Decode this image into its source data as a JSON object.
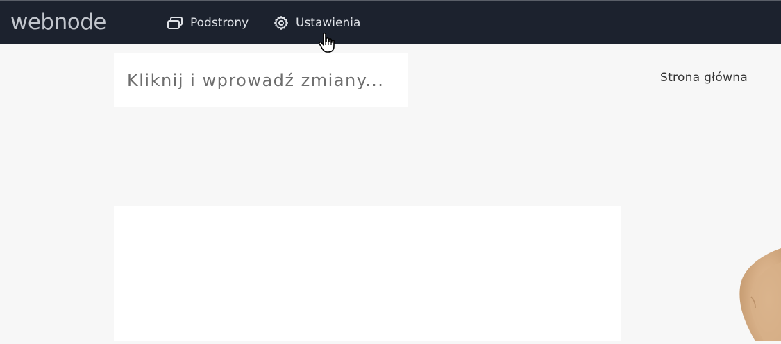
{
  "topbar": {
    "logo": "webnode",
    "nav": [
      {
        "label": "Podstrony",
        "icon": "pages-icon"
      },
      {
        "label": "Ustawienia",
        "icon": "gear-icon"
      }
    ]
  },
  "page": {
    "title_placeholder": "Kliknij i wprowadź zmiany...",
    "menu": [
      {
        "label": "Strona główna"
      }
    ]
  },
  "colors": {
    "topbar_bg": "#1c222e",
    "page_bg": "#f7f7f7",
    "accent_shape": "#d9b48f"
  }
}
